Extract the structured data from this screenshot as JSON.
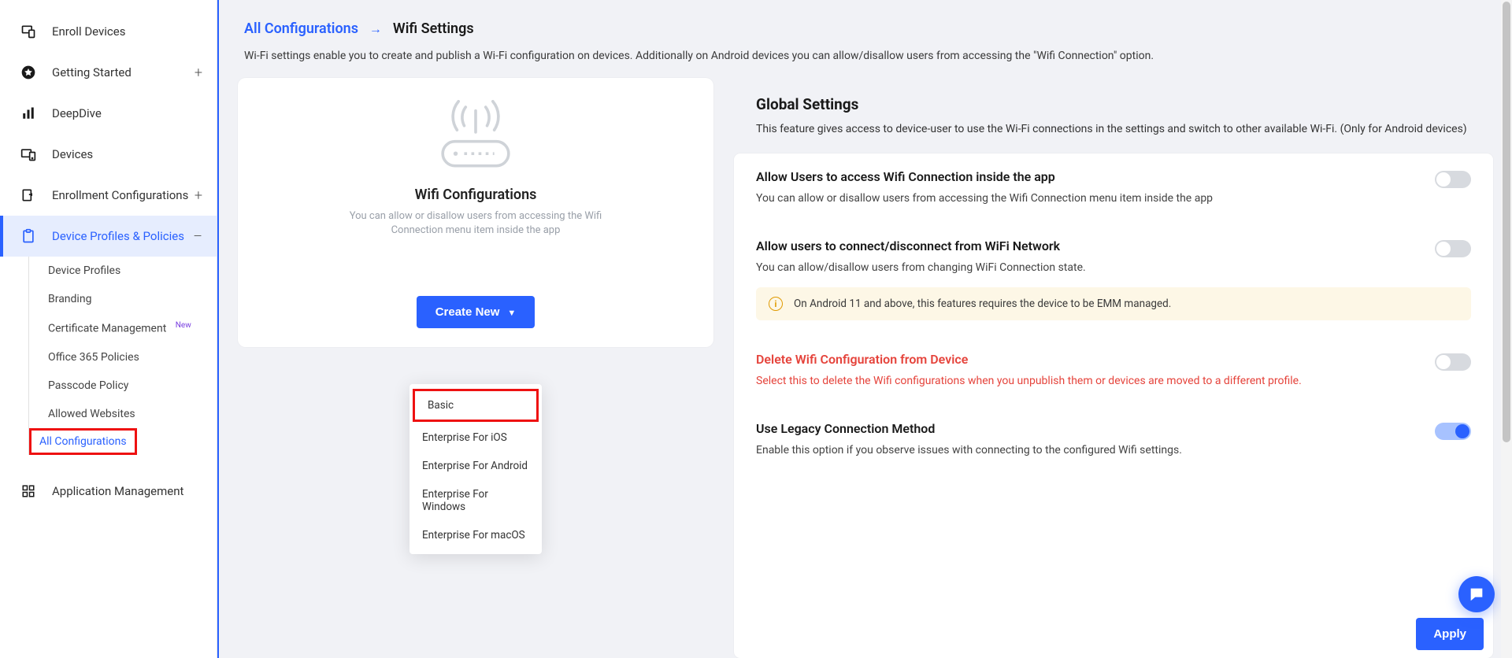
{
  "sidebar": {
    "items": [
      {
        "label": "Enroll Devices",
        "icon": "enroll"
      },
      {
        "label": "Getting Started",
        "icon": "star",
        "expand": "+"
      },
      {
        "label": "DeepDive",
        "icon": "bars"
      },
      {
        "label": "Devices",
        "icon": "devices"
      },
      {
        "label": "Enrollment Configurations",
        "icon": "enroll-conf",
        "expand": "+"
      },
      {
        "label": "Device Profiles & Policies",
        "icon": "clipboard",
        "expand": "–",
        "active": true
      },
      {
        "label": "Application Management",
        "icon": "grid"
      }
    ],
    "subitems": [
      {
        "label": "Device Profiles"
      },
      {
        "label": "Branding"
      },
      {
        "label": "Certificate Management",
        "badge": "New"
      },
      {
        "label": "Office 365 Policies"
      },
      {
        "label": "Passcode Policy"
      },
      {
        "label": "Allowed Websites"
      },
      {
        "label": "All Configurations",
        "selected": true
      }
    ]
  },
  "breadcrumb": {
    "link": "All Configurations",
    "current": "Wifi Settings"
  },
  "page_subtitle": "Wi-Fi settings enable you to create and publish a Wi-Fi configuration on devices. Additionally on Android devices you can allow/disallow users from accessing the \"Wifi Connection\" option.",
  "left": {
    "title": "Wifi Configurations",
    "desc": "You can allow or disallow users from accessing the Wifi Connection menu item inside the app",
    "create_label": "Create New",
    "dropdown": [
      "Basic",
      "Enterprise For iOS",
      "Enterprise For Android",
      "Enterprise For Windows",
      "Enterprise For macOS"
    ]
  },
  "global": {
    "heading": "Global Settings",
    "desc": "This feature gives access to device-user to use the Wi-Fi connections in the settings and switch to other available Wi-Fi. (Only for Android devices)",
    "settings": [
      {
        "title": "Allow Users to access Wifi Connection inside the app",
        "desc": "You can allow or disallow users from accessing the Wifi Connection menu item inside the app",
        "on": false
      },
      {
        "title": "Allow users to connect/disconnect from WiFi Network",
        "desc": "You can allow/disallow users from changing WiFi Connection state.",
        "on": false,
        "info": "On Android 11 and above, this features requires the device to be EMM managed."
      },
      {
        "title": "Delete Wifi Configuration from Device",
        "desc": "Select this to delete the Wifi configurations when you unpublish them or devices are moved to a different profile.",
        "on": false,
        "danger": true
      },
      {
        "title": "Use Legacy Connection Method",
        "desc": "Enable this option if you observe issues with connecting to the configured Wifi settings.",
        "on": true
      }
    ]
  },
  "apply_label": "Apply"
}
